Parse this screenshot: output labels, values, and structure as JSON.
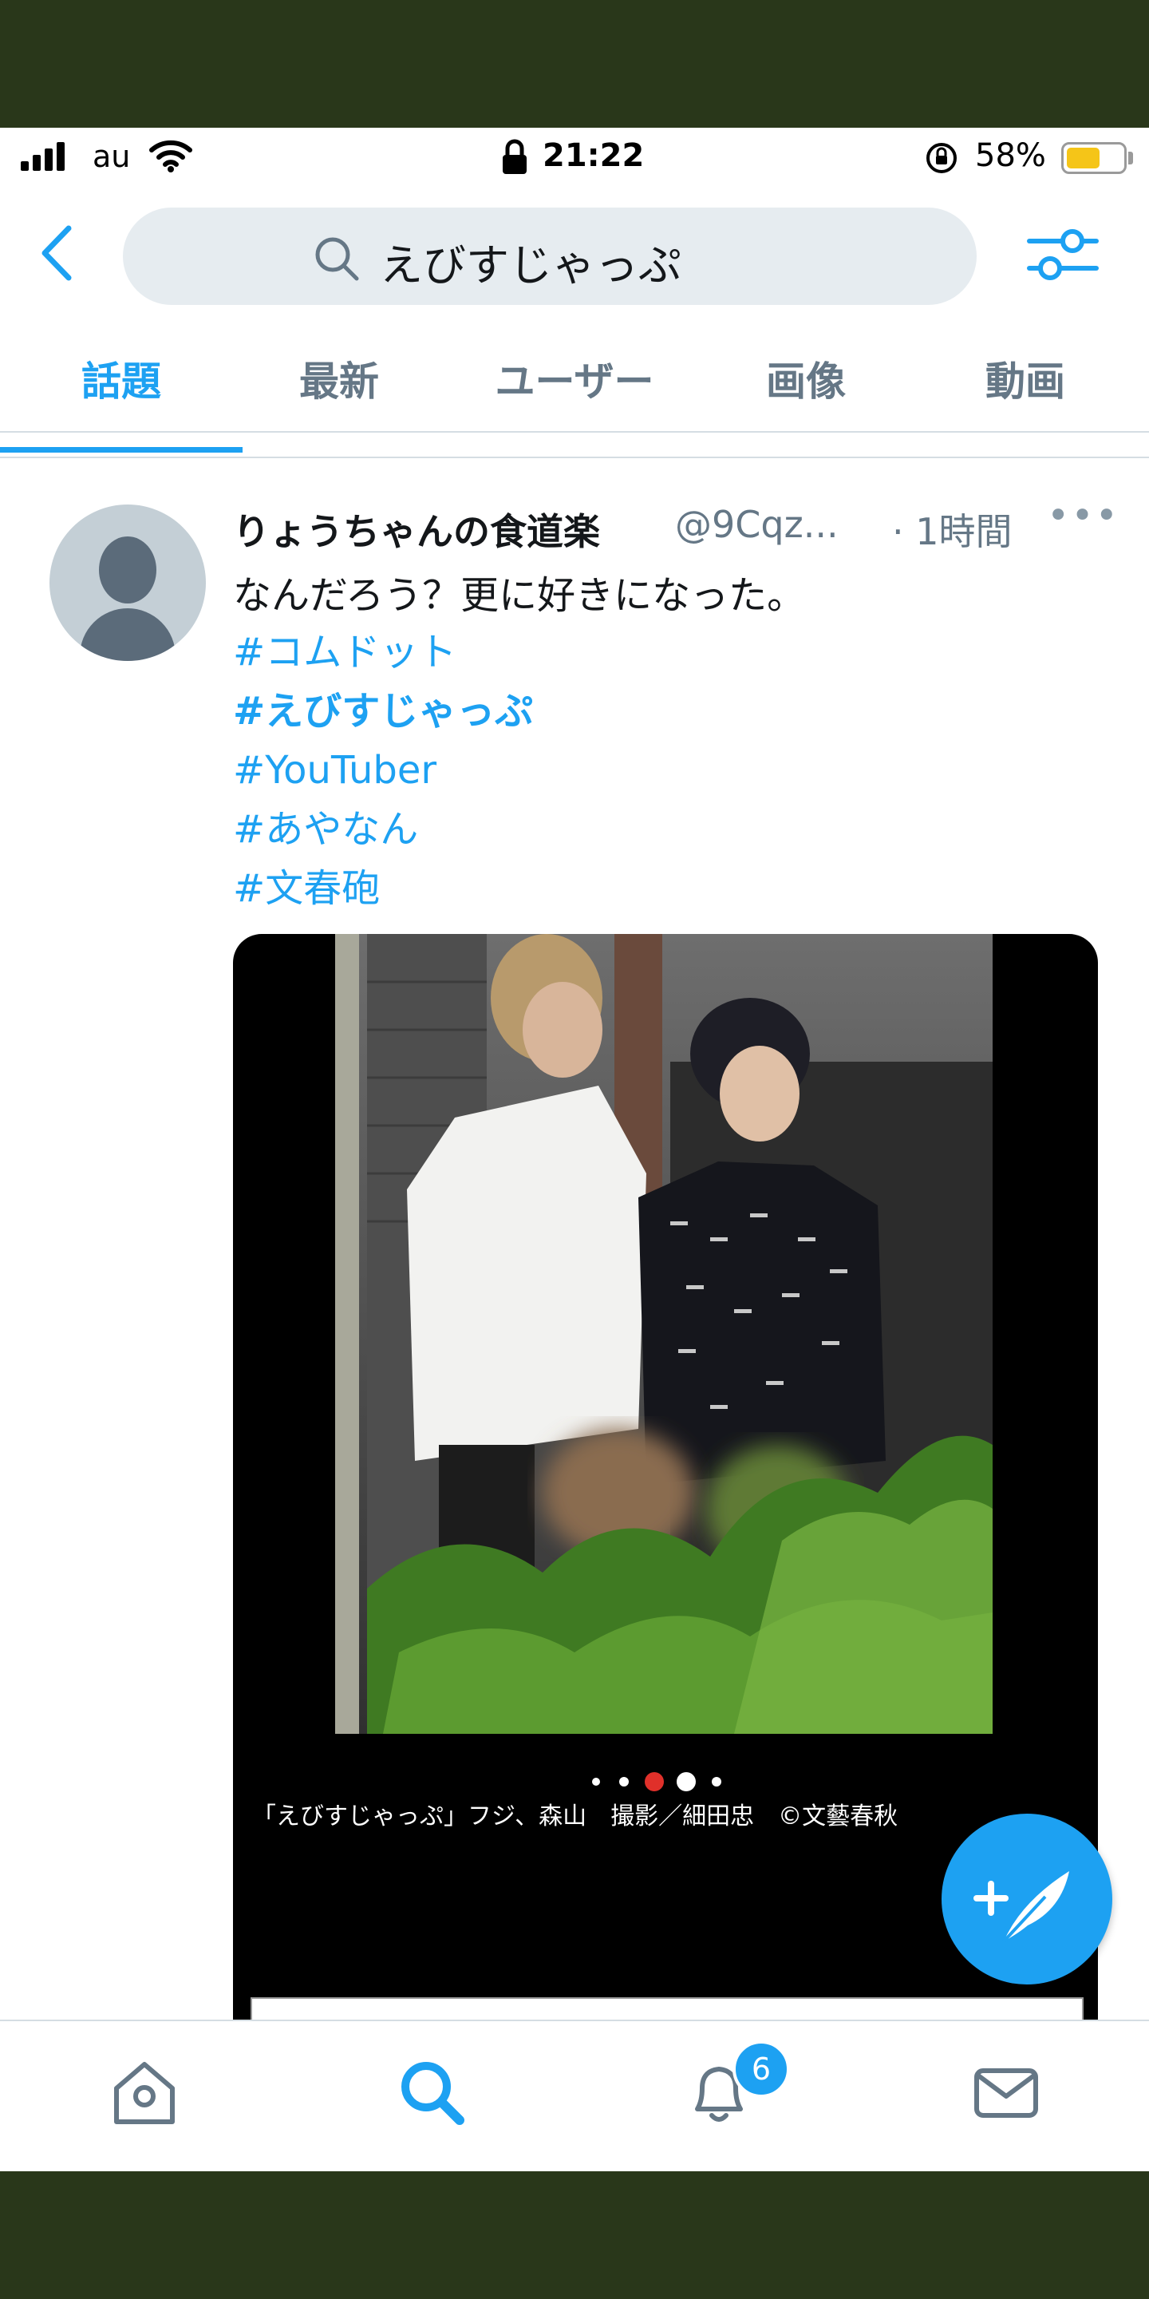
{
  "status_bar": {
    "carrier": "au",
    "time": "21:22",
    "battery_percent_label": "58%",
    "battery_level": 0.58,
    "icons": [
      "signal-icon",
      "wifi-icon",
      "lock-icon",
      "rotation-lock-icon",
      "battery-icon"
    ]
  },
  "search": {
    "query": "えびすじゃっぷ",
    "icons": [
      "back-chevron-icon",
      "search-icon",
      "filter-sliders-icon"
    ]
  },
  "tabs": [
    {
      "label": "話題",
      "active": true
    },
    {
      "label": "最新",
      "active": false
    },
    {
      "label": "ユーザー",
      "active": false
    },
    {
      "label": "画像",
      "active": false
    },
    {
      "label": "動画",
      "active": false
    }
  ],
  "tweet": {
    "name": "りょうちゃんの食道楽",
    "handle": "@9Cqz...",
    "time": "· 1時間",
    "more": "•••",
    "text": "なんだろう？更に好きになった。",
    "hashtags": [
      {
        "text": "#コムドット",
        "bold": false
      },
      {
        "text": "#えびすじゃっぷ",
        "bold": true
      },
      {
        "text": "#YouTuber",
        "bold": false
      },
      {
        "text": "#あやなん",
        "bold": false
      },
      {
        "text": "#文春砲",
        "bold": false
      }
    ],
    "media": {
      "caption": "「えびすじゃっぷ」フジ、森山　撮影／細田忠　©文藝春秋",
      "carousel_total": 5,
      "carousel_current": 3
    }
  },
  "fab": {
    "icon": "compose-feather-icon"
  },
  "bottom_nav": {
    "items": [
      "home-icon",
      "search-icon",
      "notifications-icon",
      "messages-icon"
    ],
    "active": "search-icon",
    "notification_badge": "6"
  },
  "colors": {
    "accent": "#1da1f2",
    "text": "#14171a",
    "secondary": "#657786",
    "search_bg": "#e6ecf0",
    "backdrop": "#29371a"
  }
}
